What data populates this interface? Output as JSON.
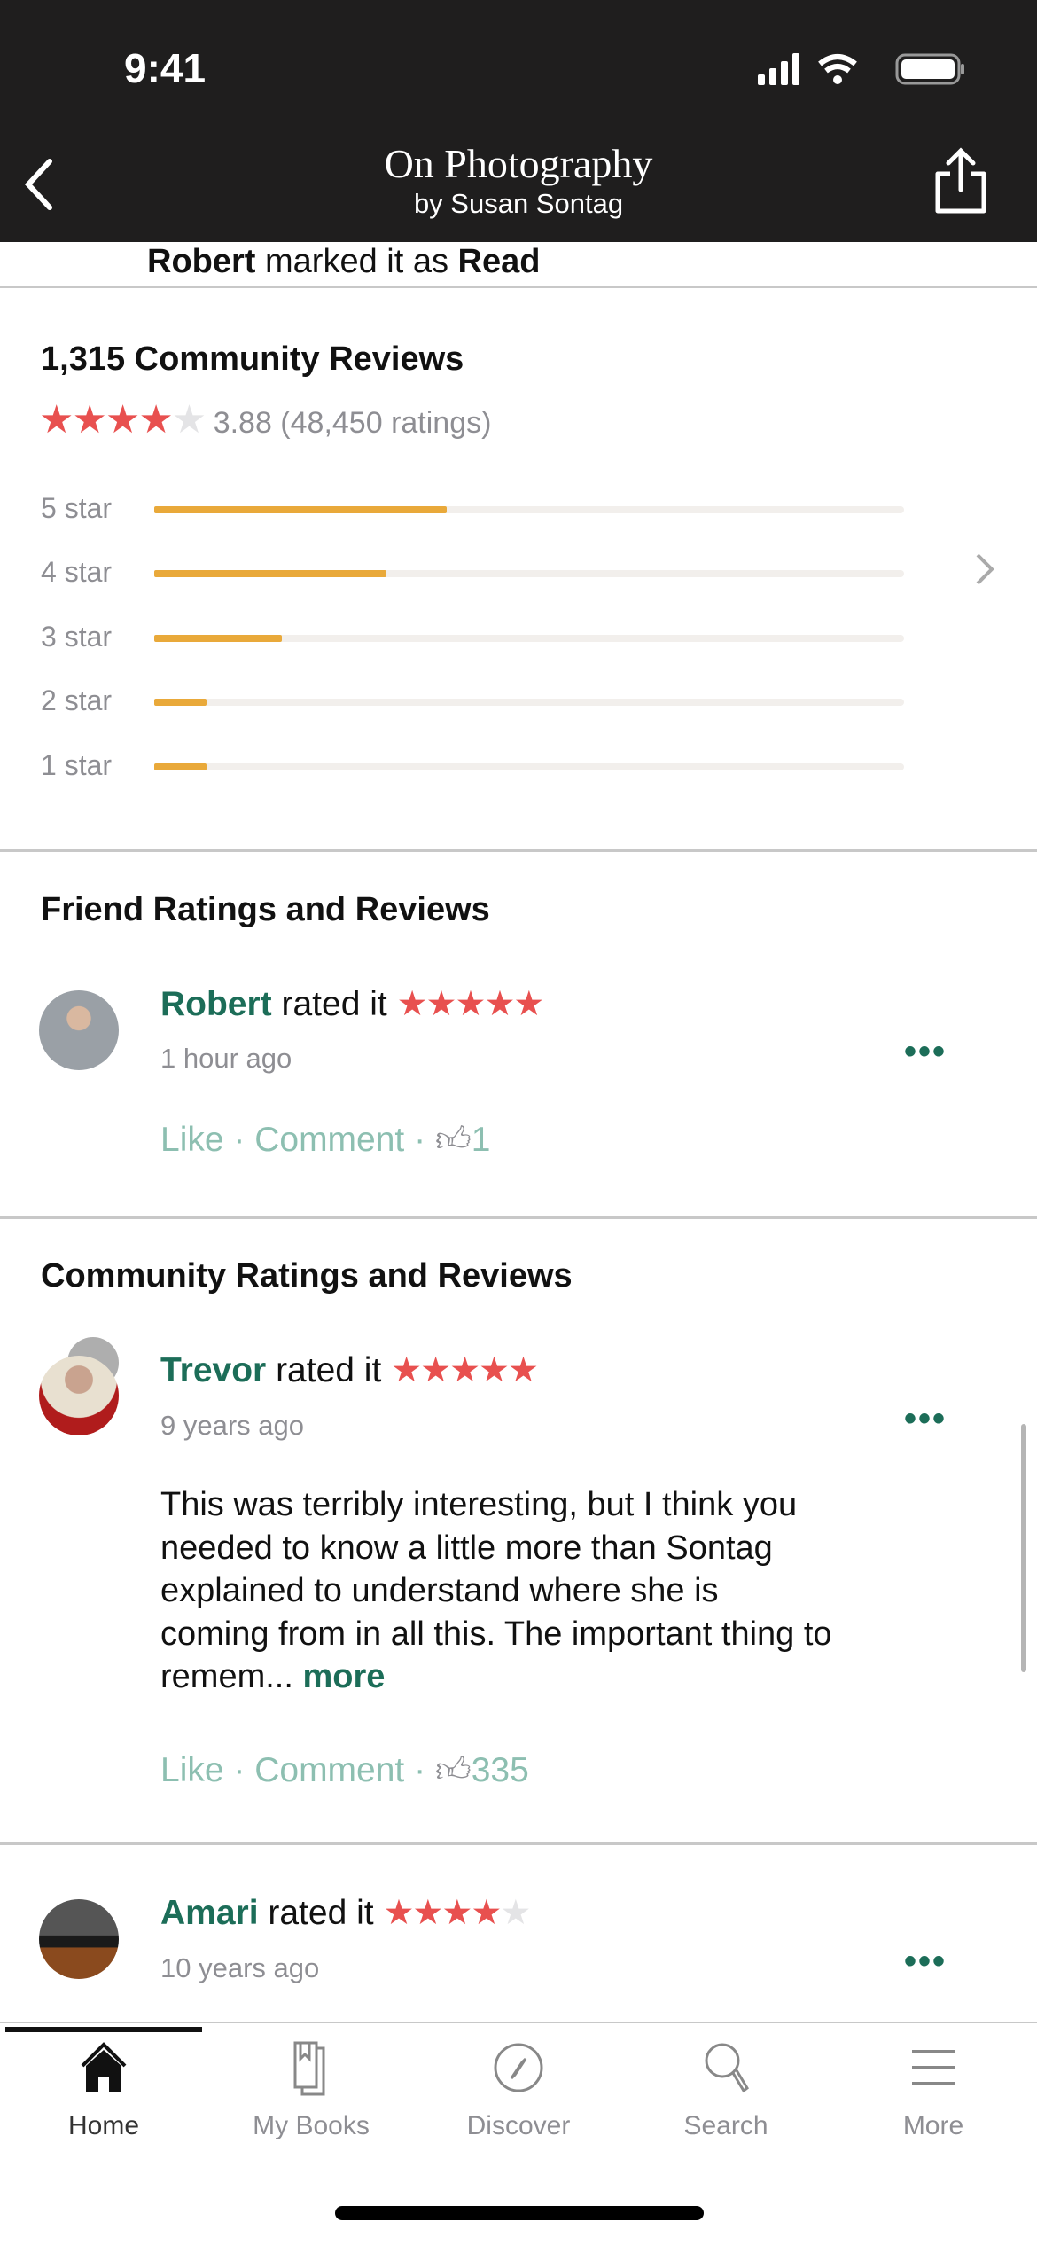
{
  "status_bar": {
    "time": "9:41"
  },
  "header": {
    "title": "On Photography",
    "subtitle": "by Susan Sontag"
  },
  "activity": {
    "user": "Robert",
    "text": " marked it as ",
    "status": "Read"
  },
  "community": {
    "heading": "1,315 Community Reviews",
    "average_rating": 3.88,
    "rating_text": "3.88 (48,450 ratings)",
    "distribution": [
      {
        "label": "5 star",
        "percent": 39
      },
      {
        "label": "4 star",
        "percent": 31
      },
      {
        "label": "3 star",
        "percent": 17
      },
      {
        "label": "2 star",
        "percent": 7
      },
      {
        "label": "1 star",
        "percent": 7
      }
    ]
  },
  "friends": {
    "heading": "Friend Ratings and Reviews",
    "review": {
      "name": "Robert",
      "rated": " rated it ",
      "stars": 5,
      "time": "1 hour ago",
      "like": "Like",
      "comment": "Comment",
      "likes": "1"
    }
  },
  "community_reviews": {
    "heading": "Community Ratings and Reviews",
    "reviews": [
      {
        "name": "Trevor",
        "rated": " rated it ",
        "stars": 5,
        "time": "9 years ago",
        "text": "This was terribly interesting, but I think you needed to know a little more than Sontag explained to understand where she is coming from in all this. The important thing to remem... ",
        "more": "more",
        "like": "Like",
        "comment": "Comment",
        "likes": "335"
      },
      {
        "name": "Amari",
        "rated": " rated it ",
        "stars": 4,
        "time": "10 years ago"
      }
    ]
  },
  "tabs": [
    {
      "label": "Home",
      "icon": "home-icon",
      "active": true
    },
    {
      "label": "My Books",
      "icon": "books-icon"
    },
    {
      "label": "Discover",
      "icon": "compass-icon"
    },
    {
      "label": "Search",
      "icon": "search-icon"
    },
    {
      "label": "More",
      "icon": "menu-icon"
    }
  ],
  "colors": {
    "accent": "#1c6d58",
    "star": "#e8504f",
    "bar": "#e9a93a",
    "header": "#1f1e1e"
  }
}
